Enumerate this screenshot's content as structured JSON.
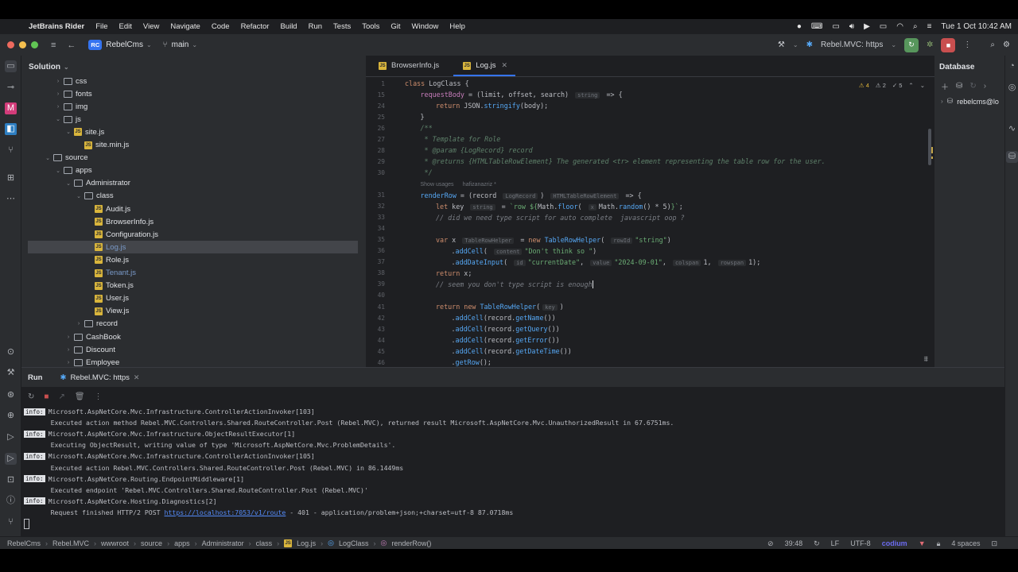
{
  "menubar": {
    "app_name": "JetBrains Rider",
    "items": [
      "File",
      "Edit",
      "View",
      "Navigate",
      "Code",
      "Refactor",
      "Build",
      "Run",
      "Tests",
      "Tools",
      "Git",
      "Window",
      "Help"
    ],
    "clock": "Tue 1 Oct  10:42 AM"
  },
  "titlebar": {
    "project_badge": "RC",
    "project_name": "RebelCms",
    "branch": "main",
    "run_config": "Rebel.MVC: https"
  },
  "solution": {
    "title": "Solution",
    "tree": [
      {
        "label": "css",
        "type": "folder",
        "indent": 3,
        "expanded": false
      },
      {
        "label": "fonts",
        "type": "folder",
        "indent": 3,
        "expanded": false
      },
      {
        "label": "img",
        "type": "folder",
        "indent": 3,
        "expanded": false
      },
      {
        "label": "js",
        "type": "folder",
        "indent": 3,
        "expanded": true
      },
      {
        "label": "site.js",
        "type": "file",
        "indent": 4,
        "expanded": true
      },
      {
        "label": "site.min.js",
        "type": "file",
        "indent": 5,
        "expanded": null
      },
      {
        "label": "source",
        "type": "folder",
        "indent": 2,
        "expanded": true
      },
      {
        "label": "apps",
        "type": "folder",
        "indent": 3,
        "expanded": true
      },
      {
        "label": "Administrator",
        "type": "folder",
        "indent": 4,
        "expanded": true
      },
      {
        "label": "class",
        "type": "folder",
        "indent": 5,
        "expanded": true
      },
      {
        "label": "Audit.js",
        "type": "file",
        "indent": 6
      },
      {
        "label": "BrowserInfo.js",
        "type": "file",
        "indent": 6
      },
      {
        "label": "Configuration.js",
        "type": "file",
        "indent": 6
      },
      {
        "label": "Log.js",
        "type": "file",
        "indent": 6,
        "selected": true,
        "muted": true
      },
      {
        "label": "Role.js",
        "type": "file",
        "indent": 6
      },
      {
        "label": "Tenant.js",
        "type": "file",
        "indent": 6,
        "muted": true
      },
      {
        "label": "Token.js",
        "type": "file",
        "indent": 6
      },
      {
        "label": "User.js",
        "type": "file",
        "indent": 6
      },
      {
        "label": "View.js",
        "type": "file",
        "indent": 6
      },
      {
        "label": "record",
        "type": "folder",
        "indent": 5,
        "expanded": false
      },
      {
        "label": "CashBook",
        "type": "folder",
        "indent": 4,
        "expanded": false
      },
      {
        "label": "Discount",
        "type": "folder",
        "indent": 4,
        "expanded": false
      },
      {
        "label": "Employee",
        "type": "folder",
        "indent": 4,
        "expanded": false
      }
    ]
  },
  "editor": {
    "tabs": [
      {
        "label": "BrowserInfo.js",
        "active": false
      },
      {
        "label": "Log.js",
        "active": true
      }
    ],
    "inspections": {
      "warnings": "4",
      "weak": "2",
      "typos": "5"
    },
    "lines": [
      {
        "n": "1",
        "indent": 0,
        "segments": [
          [
            "kw",
            "class "
          ],
          [
            "cls",
            "LogClass {"
          ]
        ]
      },
      {
        "n": "15",
        "indent": 1,
        "segments": [
          [
            "prop",
            "requestBody"
          ],
          [
            "cls",
            " = (limit, offset, search) "
          ],
          [
            "hint",
            "string"
          ],
          [
            "cls",
            " => {"
          ]
        ]
      },
      {
        "n": "24",
        "indent": 2,
        "segments": [
          [
            "kw",
            "return "
          ],
          [
            "cls",
            "JSON."
          ],
          [
            "fn",
            "stringify"
          ],
          [
            "cls",
            "(body);"
          ]
        ]
      },
      {
        "n": "25",
        "indent": 1,
        "segments": [
          [
            "cls",
            "}"
          ]
        ]
      },
      {
        "n": "26",
        "indent": 1,
        "segments": [
          [
            "doc",
            "/**"
          ]
        ]
      },
      {
        "n": "27",
        "indent": 1,
        "segments": [
          [
            "doc",
            " * Template for Role"
          ]
        ]
      },
      {
        "n": "28",
        "indent": 1,
        "segments": [
          [
            "doc",
            " * @param {LogRecord} record"
          ]
        ]
      },
      {
        "n": "29",
        "indent": 1,
        "segments": [
          [
            "doc",
            " * @returns {HTMLTableRowElement} The generated <tr> element representing the table row for the user."
          ]
        ]
      },
      {
        "n": "30",
        "indent": 1,
        "segments": [
          [
            "doc",
            " */"
          ]
        ]
      },
      {
        "n": "",
        "indent": 1,
        "segments": [
          [
            "usage",
            "Show usages     hafizanazriz *"
          ]
        ]
      },
      {
        "n": "31",
        "indent": 1,
        "segments": [
          [
            "fn",
            "renderRow"
          ],
          [
            "cls",
            " = (record "
          ],
          [
            "hint",
            "LogRecord"
          ],
          [
            "cls",
            ") "
          ],
          [
            "hint",
            "HTMLTableRowElement"
          ],
          [
            "cls",
            " => {"
          ]
        ]
      },
      {
        "n": "32",
        "indent": 2,
        "segments": [
          [
            "kw",
            "let "
          ],
          [
            "cls",
            "key "
          ],
          [
            "hint",
            "string"
          ],
          [
            "cls",
            " = "
          ],
          [
            "str",
            "`row ${"
          ],
          [
            "cls",
            "Math."
          ],
          [
            "fn",
            "floor"
          ],
          [
            "cls",
            "( "
          ],
          [
            "hint",
            "x"
          ],
          [
            "cls",
            "Math."
          ],
          [
            "fn",
            "random"
          ],
          [
            "cls",
            "() * 5)"
          ],
          [
            "str",
            "}`"
          ],
          [
            "cls",
            ";"
          ]
        ]
      },
      {
        "n": "33",
        "indent": 2,
        "segments": [
          [
            "cm",
            "// did we need type script for auto complete  javascript oop ?"
          ]
        ]
      },
      {
        "n": "34",
        "indent": 0,
        "segments": []
      },
      {
        "n": "35",
        "indent": 2,
        "segments": [
          [
            "kw",
            "var "
          ],
          [
            "cls",
            "x "
          ],
          [
            "hint",
            "TableRowHelper"
          ],
          [
            "cls",
            " = "
          ],
          [
            "kw",
            "new "
          ],
          [
            "fn",
            "TableRowHelper"
          ],
          [
            "cls",
            "( "
          ],
          [
            "hint",
            "rowId"
          ],
          [
            "str",
            "\"string\""
          ],
          [
            "cls",
            ")"
          ]
        ]
      },
      {
        "n": "36",
        "indent": 3,
        "segments": [
          [
            "cls",
            "."
          ],
          [
            "fn",
            "addCell"
          ],
          [
            "cls",
            "( "
          ],
          [
            "hint",
            "content"
          ],
          [
            "str",
            "\"Don't think so \""
          ],
          [
            "cls",
            ")"
          ]
        ]
      },
      {
        "n": "37",
        "indent": 3,
        "segments": [
          [
            "cls",
            "."
          ],
          [
            "fn",
            "addDateInput"
          ],
          [
            "cls",
            "( "
          ],
          [
            "hint",
            "id"
          ],
          [
            "str",
            "\"currentDate\""
          ],
          [
            "cls",
            ", "
          ],
          [
            "hint",
            "value"
          ],
          [
            "str",
            "\"2024-09-01\""
          ],
          [
            "cls",
            ", "
          ],
          [
            "hint",
            "colspan"
          ],
          [
            "cls",
            "1, "
          ],
          [
            "hint",
            "rowspan"
          ],
          [
            "cls",
            "1);"
          ]
        ]
      },
      {
        "n": "38",
        "indent": 2,
        "segments": [
          [
            "kw",
            "return "
          ],
          [
            "cls",
            "x;"
          ]
        ]
      },
      {
        "n": "39",
        "indent": 2,
        "segments": [
          [
            "cm",
            "// seem you don't type script is enough"
          ]
        ]
      },
      {
        "n": "40",
        "indent": 0,
        "segments": []
      },
      {
        "n": "41",
        "indent": 2,
        "segments": [
          [
            "kw",
            "return new "
          ],
          [
            "fn",
            "TableRowHelper"
          ],
          [
            "cls",
            "("
          ],
          [
            "hint",
            "key"
          ],
          [
            "cls",
            ")"
          ]
        ]
      },
      {
        "n": "42",
        "indent": 3,
        "segments": [
          [
            "cls",
            "."
          ],
          [
            "fn",
            "addCell"
          ],
          [
            "cls",
            "(record."
          ],
          [
            "fn",
            "getName"
          ],
          [
            "cls",
            "())"
          ]
        ]
      },
      {
        "n": "43",
        "indent": 3,
        "segments": [
          [
            "cls",
            "."
          ],
          [
            "fn",
            "addCell"
          ],
          [
            "cls",
            "(record."
          ],
          [
            "fn",
            "getQuery"
          ],
          [
            "cls",
            "())"
          ]
        ]
      },
      {
        "n": "44",
        "indent": 3,
        "segments": [
          [
            "cls",
            "."
          ],
          [
            "fn",
            "addCell"
          ],
          [
            "cls",
            "(record."
          ],
          [
            "fn",
            "getError"
          ],
          [
            "cls",
            "())"
          ]
        ]
      },
      {
        "n": "45",
        "indent": 3,
        "segments": [
          [
            "cls",
            "."
          ],
          [
            "fn",
            "addCell"
          ],
          [
            "cls",
            "(record."
          ],
          [
            "fn",
            "getDateTime"
          ],
          [
            "cls",
            "())"
          ]
        ]
      },
      {
        "n": "46",
        "indent": 3,
        "segments": [
          [
            "cls",
            "."
          ],
          [
            "fn",
            "getRow"
          ],
          [
            "cls",
            "();"
          ]
        ]
      }
    ]
  },
  "database_panel": {
    "title": "Database",
    "item": "rebelcms@lo"
  },
  "run_panel": {
    "title": "Run",
    "tab": "Rebel.MVC: https",
    "log": [
      {
        "info": true,
        "text": "Microsoft.AspNetCore.Mvc.Infrastructure.ControllerActionInvoker[103]"
      },
      {
        "info": false,
        "text": "      Executed action method Rebel.MVC.Controllers.Shared.RouteController.Post (Rebel.MVC), returned result Microsoft.AspNetCore.Mvc.UnauthorizedResult in 67.6751ms."
      },
      {
        "info": true,
        "text": "Microsoft.AspNetCore.Mvc.Infrastructure.ObjectResultExecutor[1]"
      },
      {
        "info": false,
        "text": "      Executing ObjectResult, writing value of type 'Microsoft.AspNetCore.Mvc.ProblemDetails'."
      },
      {
        "info": true,
        "text": "Microsoft.AspNetCore.Mvc.Infrastructure.ControllerActionInvoker[105]"
      },
      {
        "info": false,
        "text": "      Executed action Rebel.MVC.Controllers.Shared.RouteController.Post (Rebel.MVC) in 86.1449ms"
      },
      {
        "info": true,
        "text": "Microsoft.AspNetCore.Routing.EndpointMiddleware[1]"
      },
      {
        "info": false,
        "text": "      Executed endpoint 'Rebel.MVC.Controllers.Shared.RouteController.Post (Rebel.MVC)'"
      },
      {
        "info": true,
        "text": "Microsoft.AspNetCore.Hosting.Diagnostics[2]"
      },
      {
        "info": false,
        "text": "      Request finished HTTP/2 POST ",
        "link": "https://localhost:7053/v1/route",
        "after": " - 401 - application/problem+json;+charset=utf-8 87.0718ms"
      }
    ],
    "info_label": "info:"
  },
  "statusbar": {
    "breadcrumbs": [
      "RebelCms",
      "Rebel.MVC",
      "wwwroot",
      "source",
      "apps",
      "Administrator",
      "class",
      "Log.js",
      "LogClass",
      "renderRow()"
    ],
    "position": "39:48",
    "line_sep": "LF",
    "encoding": "UTF-8",
    "plugin": "codium",
    "indent": "4 spaces"
  },
  "colors": {
    "accent": "#3574f0",
    "run_green": "#57965c",
    "stop_red": "#c94f4f"
  }
}
